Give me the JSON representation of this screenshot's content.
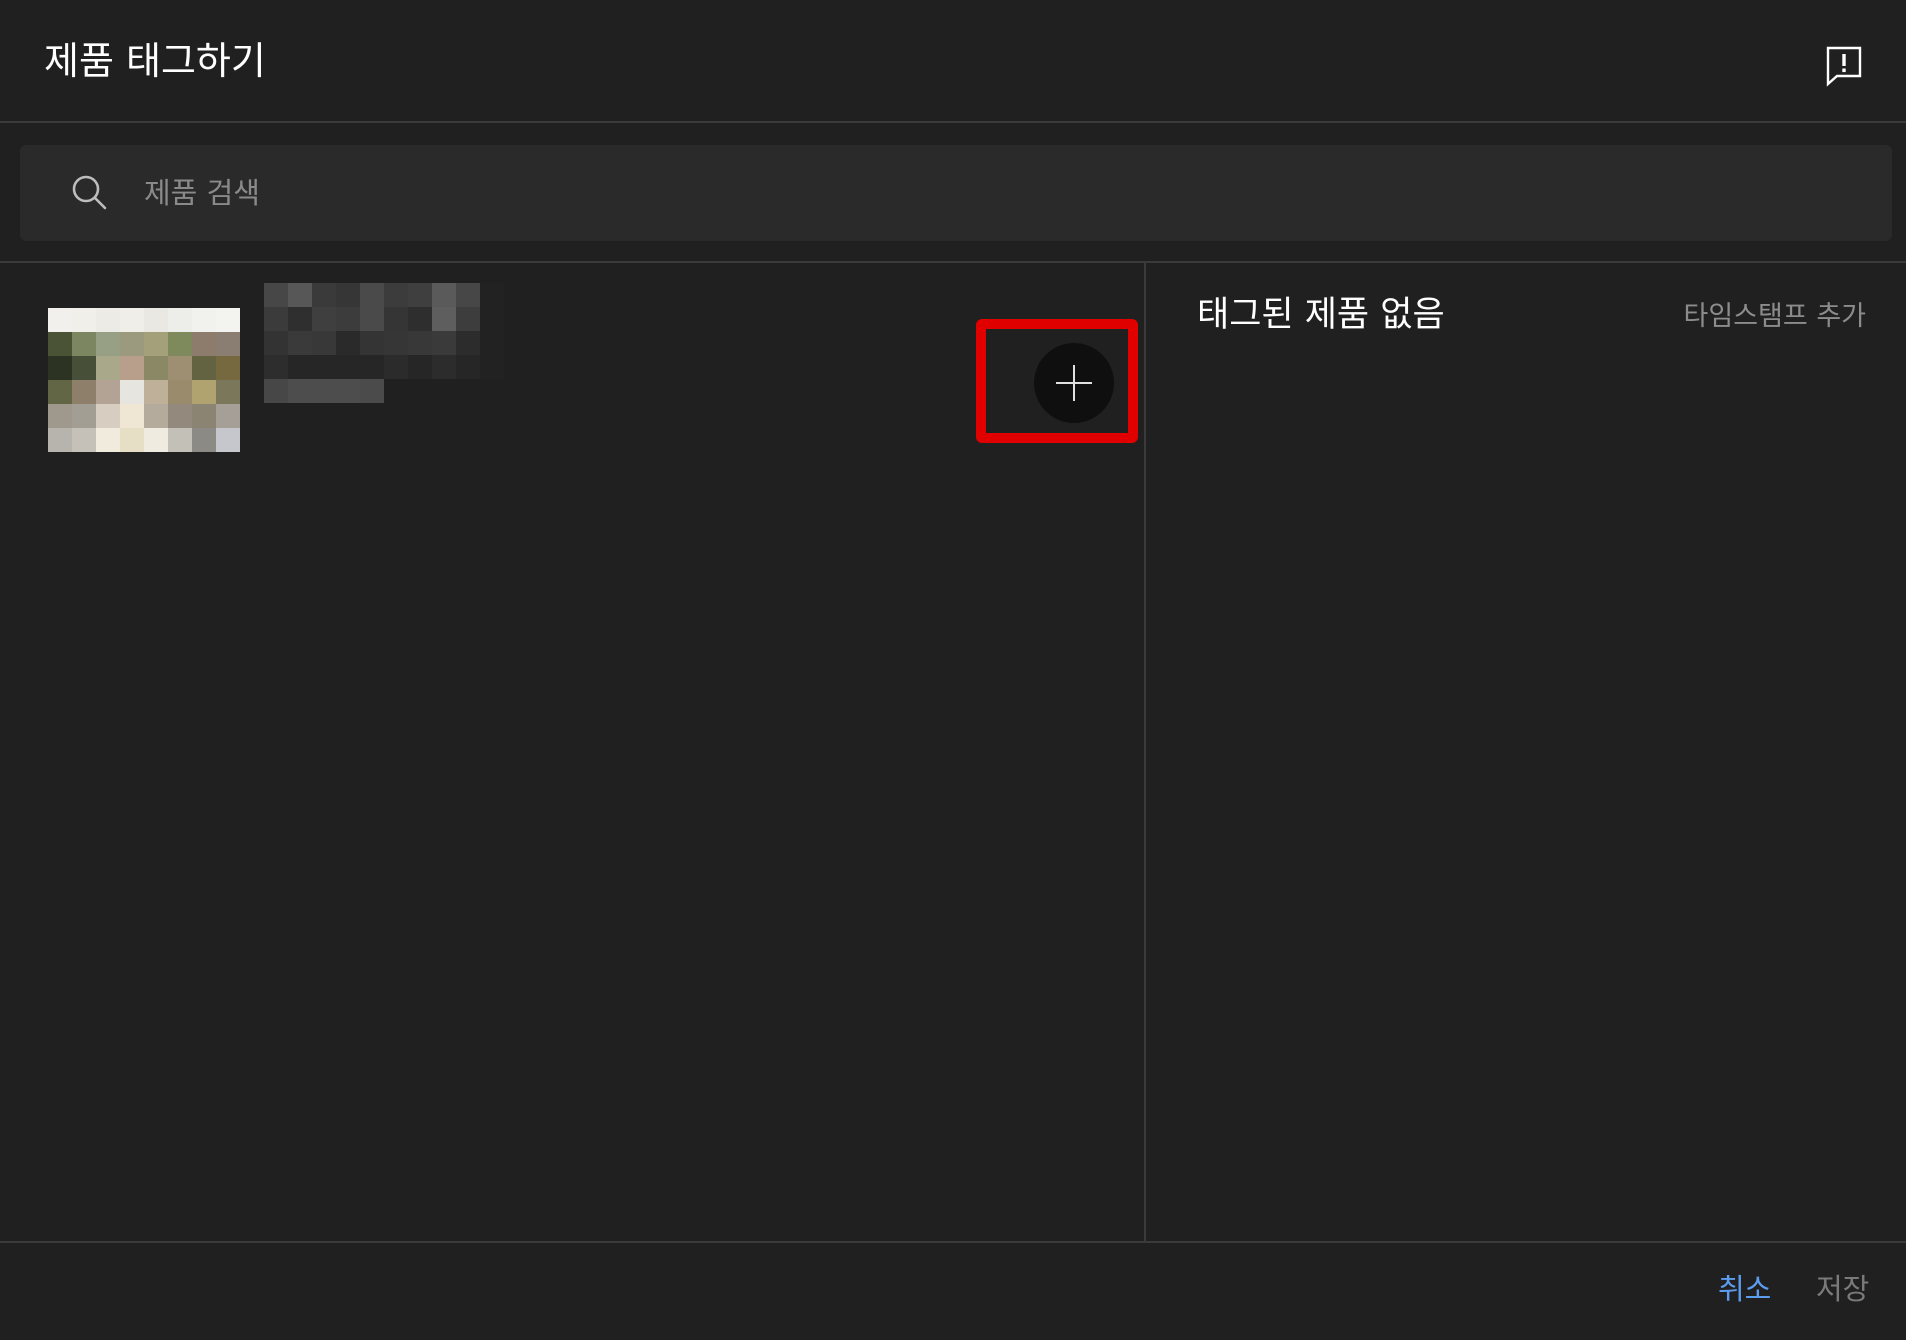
{
  "header": {
    "title": "제품 태그하기",
    "feedback_icon": "feedback-icon"
  },
  "search": {
    "placeholder": "제품 검색",
    "value": "",
    "icon": "search-icon"
  },
  "products": [
    {
      "thumbnail_icon": "product-thumbnail",
      "name_blurred": true,
      "add_icon": "plus-icon"
    }
  ],
  "right_panel": {
    "empty_label": "태그된 제품 없음",
    "add_timestamp_label": "타임스탬프 추가"
  },
  "footer": {
    "cancel_label": "취소",
    "save_label": "저장"
  },
  "colors": {
    "background": "#202020",
    "search_background": "#2a2a2a",
    "divider": "#3a3a3a",
    "accent_blue": "#5c9df0",
    "highlight_red": "#e00000",
    "muted_text": "#8c8c8c"
  }
}
